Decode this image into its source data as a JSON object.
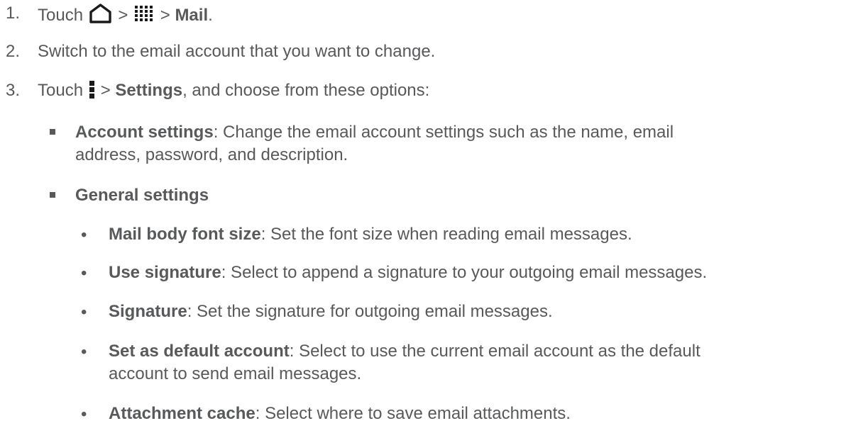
{
  "steps": [
    {
      "number": "1.",
      "prefix": "Touch",
      "sep1": ">",
      "sep2": ">",
      "target": "Mail",
      "end": "."
    },
    {
      "number": "2.",
      "text": "Switch to the email account that you want to change."
    },
    {
      "number": "3.",
      "prefix": "Touch",
      "sep1": ">",
      "target": "Settings",
      "rest": ", and choose from these options:"
    }
  ],
  "options": [
    {
      "term": "Account settings",
      "desc": ": Change the email account settings such as the name, email",
      "desc2": "address, password, and description."
    },
    {
      "term": "General settings"
    }
  ],
  "sub_options": [
    {
      "term": "Mail body font size",
      "desc": ": Set the font size when reading email messages."
    },
    {
      "term": "Use signature",
      "desc": ": Select to append a signature to your outgoing email messages."
    },
    {
      "term": "Signature",
      "desc": ": Set the signature for outgoing email messages."
    },
    {
      "term": "Set as default account",
      "desc": ": Select to use the current email account as the default",
      "desc2": "account to send email messages."
    },
    {
      "term": "Attachment cache",
      "desc": ": Select where to save email attachments."
    }
  ],
  "icons": {
    "home": "home-icon",
    "apps": "all-apps-icon",
    "menu": "overflow-menu-icon"
  },
  "colors": {
    "text": "#58595b",
    "icon": "#1a1a1a"
  }
}
